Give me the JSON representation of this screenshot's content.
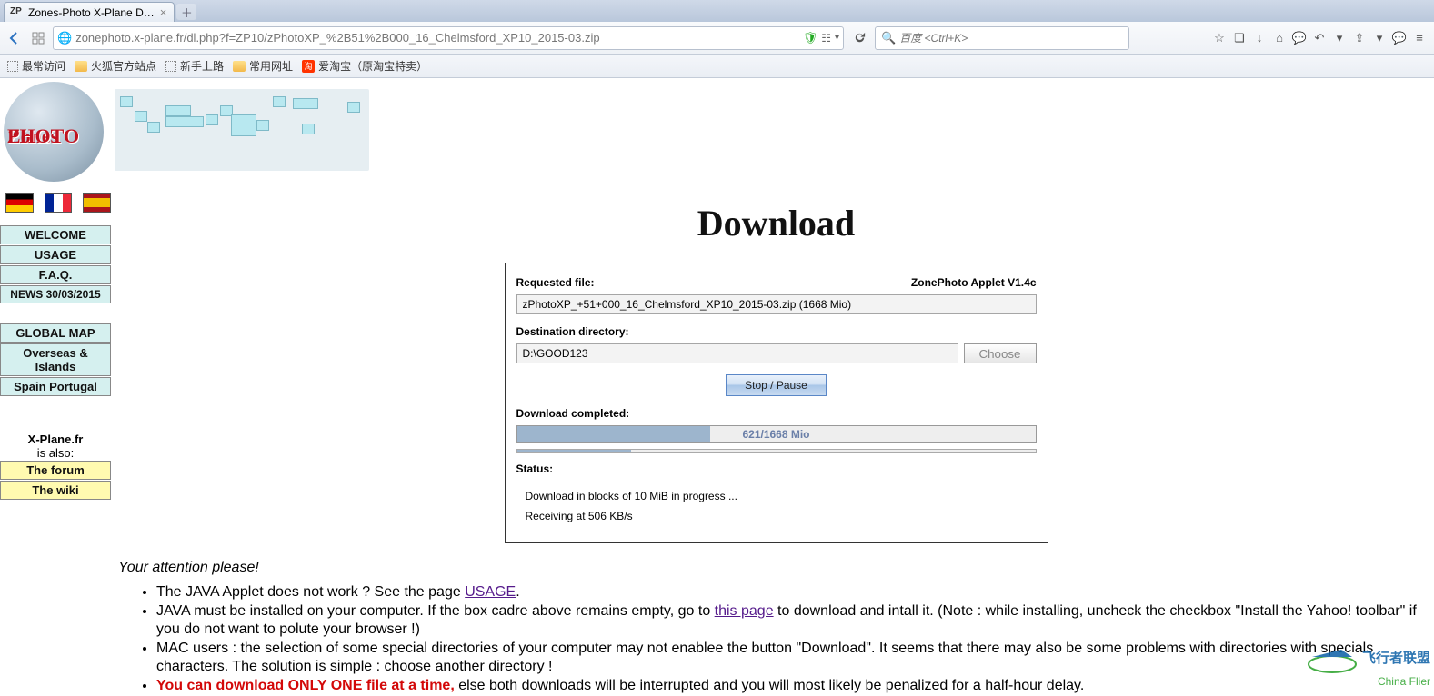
{
  "browser": {
    "tab_title": "Zones-Photo X-Plane D…",
    "tab_favicon": "ZP",
    "url": "zonephoto.x-plane.fr/dl.php?f=ZP10/zPhotoXP_%2B51%2B000_16_Chelmsford_XP10_2015-03.zip",
    "search_placeholder": "百度 <Ctrl+K>",
    "bookmarks": {
      "most": "最常访问",
      "fox": "火狐官方站点",
      "newbie": "新手上路",
      "common": "常用网址",
      "tao": "淘",
      "aitao": "爱淘宝（原淘宝特卖）"
    }
  },
  "page": {
    "title": "Download",
    "logo_main": "Zones",
    "logo_sub": "PHOTO",
    "menu": {
      "welcome": "WELCOME",
      "usage": "USAGE",
      "faq": "F.A.Q.",
      "news": "NEWS 30/03/2015",
      "globalmap": "GLOBAL MAP",
      "overseas": "Overseas & Islands",
      "spain": "Spain Portugal"
    },
    "xplane": {
      "label_bold": "X-Plane.fr",
      "label_also": "is also:",
      "forum": "The forum",
      "wiki": "The wiki"
    }
  },
  "applet": {
    "requested_file_label": "Requested file:",
    "version": "ZonePhoto Applet V1.4c",
    "file_value": "zPhotoXP_+51+000_16_Chelmsford_XP10_2015-03.zip (1668 Mio)",
    "dest_label": "Destination directory:",
    "dest_value": "D:\\GOOD123",
    "choose": "Choose",
    "stop_pause": "Stop / Pause",
    "completed_label": "Download completed:",
    "progress_text": "621/1668 Mio",
    "progress_pct": 37.2,
    "thin_pct": 22,
    "status_label": "Status:",
    "status_line1": "Download in blocks of 10 MiB in progress ...",
    "status_line2": "Receiving at 506 KB/s"
  },
  "notes": {
    "attention": "Your attention please!",
    "b1_a": "The JAVA Applet does not work ? See the page ",
    "b1_link": "USAGE",
    "b1_c": ".",
    "b2_a": "JAVA must be installed on your computer. If the box cadre above remains empty, go to ",
    "b2_link": "this page",
    "b2_c": " to download and intall it. (Note : while installing, uncheck the checkbox \"Install the Yahoo! toolbar\" if you do not want to polute your browser !)",
    "b3": "MAC users : the selection of some special directories of your computer may not enablee the button \"Download\". It seems that there may also be some problems with directories with specials characters. The solution is simple : choose another directory !",
    "b4_red": "You can download ONLY ONE file at a time,",
    "b4_rest": " else both downloads will be interrupted and you will most likely be penalized for a half-hour delay."
  },
  "watermark": {
    "cn": "飞行者联盟",
    "en": "China Flier"
  }
}
